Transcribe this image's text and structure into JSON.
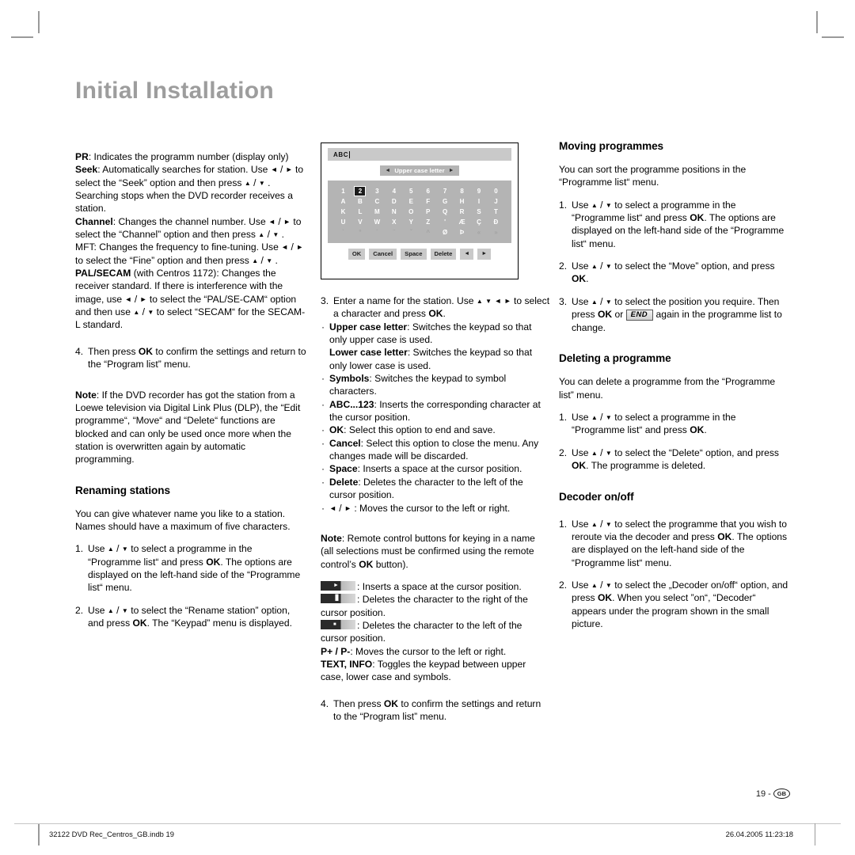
{
  "page": {
    "title": "Initial Installation",
    "page_number": "19",
    "region_badge": "GB"
  },
  "footer": {
    "file_name": "32122 DVD Rec_Centros_GB.indb   19",
    "timestamp": "26.04.2005   11:23:18"
  },
  "column1": {
    "pr_label": "PR",
    "pr_text": ": Indicates the programm number (display only)",
    "seek_label": "Seek",
    "seek_text_a": ": Automatically searches for station. Use",
    "seek_text_b": "to select the “Seek” option and then press",
    "seek_text_c": ". Searching stops when the DVD recorder receives a station.",
    "channel_label": "Channel",
    "channel_text_a": ": Changes the channel number. Use",
    "channel_text_b": "to select the “Channel” option and then press",
    "mft_text_a": "MFT: Changes the frequency to fine-tuning. Use",
    "mft_text_b": "to select the “Fine” option and then press",
    "pal_label": "PAL/SECAM",
    "pal_text_a": "(with Centros 1172): Changes the receiver standard. If there is interference with the image, use",
    "pal_text_b": "to select the “PAL/SE-CAM“ option and then use",
    "pal_text_c": "to select “SECAM“ for the SECAM-L standard.",
    "step4_marker": "4.",
    "step4_a": "Then press",
    "step4_ok": "OK",
    "step4_b": "to confirm the settings and return to the “Program list” menu.",
    "note_label": "Note",
    "note_text": ": If the DVD recorder has got the station from a Loewe television via Digital Link Plus (DLP), the “Edit programme“, “Move“ and “Delete“ functions are blocked and can only be used once more when the station is overwritten again by automatic programming.",
    "renaming_heading": "Renaming stations",
    "renaming_intro": "You can give whatever name you like to a station. Names should have a maximum of five characters.",
    "rn1_marker": "1.",
    "rn1_a": "Use",
    "rn1_b": "to select a programme in the “Programme list“ and press",
    "rn1_ok": "OK",
    "rn1_c": ". The options are displayed on the left-hand side of the “Programme list“ menu.",
    "rn2_marker": "2.",
    "rn2_a": "Use",
    "rn2_b": "to select the “Rename station” option, and press",
    "rn2_ok": "OK",
    "rn2_c": ". The “Keypad” menu is displayed."
  },
  "keypad_figure": {
    "entry_text": "ABC",
    "mode_label": "Upper case letter",
    "mode_arrow_left": "◄",
    "mode_arrow_right": "►",
    "rows": [
      [
        "1",
        "2",
        "3",
        "4",
        "5",
        "6",
        "7",
        "8",
        "9",
        "0"
      ],
      [
        "A",
        "B",
        "C",
        "D",
        "E",
        "F",
        "G",
        "H",
        "I",
        "J"
      ],
      [
        "K",
        "L",
        "M",
        "N",
        "O",
        "P",
        "Q",
        "R",
        "S",
        "T"
      ],
      [
        "U",
        "V",
        "W",
        "X",
        "Y",
        "Z",
        "'",
        "Æ",
        "Ç",
        "Ð"
      ],
      [
        "`",
        "°",
        "´",
        "¨",
        "ˇ",
        "^",
        "Ø",
        "Þ",
        "«",
        "»"
      ]
    ],
    "selected_key": "2",
    "buttons": [
      "OK",
      "Cancel",
      "Space",
      "Delete",
      "◄",
      "►"
    ]
  },
  "column2": {
    "step3_marker": "3.",
    "step3_a": "Enter a name for the station. Use",
    "step3_b": "to select a character and press",
    "step3_ok": "OK",
    "step3_c": ".",
    "upper_label": "Upper case letter",
    "upper_text": ": Switches the keypad so that only upper case is used.",
    "lower_label": "Lower case letter",
    "lower_text": ": Switches the keypad so that only lower case is used.",
    "symbols_label": "Symbols",
    "symbols_text": ": Switches the keypad to symbol characters.",
    "abc_label": "ABC...123",
    "abc_text": ": Inserts the corresponding character at the cursor position.",
    "ok_label": "OK",
    "ok_text": ": Select this option to end and save.",
    "cancel_label": "Cancel",
    "cancel_text": ": Select this option to close the menu. Any changes made will be discarded.",
    "space_label": "Space",
    "space_text": ": Inserts a space at the cursor position.",
    "delete_label": "Delete",
    "delete_text": ": Deletes the character to the left of the cursor position.",
    "cursor_text": ": Moves the cursor to the left or right.",
    "note_label": "Note",
    "note_a": ": Remote control buttons for keying in a name (all selections must be confirmed using the remote control’s",
    "note_ok": "OK",
    "note_b": "button).",
    "rc_play_text": ": Inserts a space at the cursor position.",
    "rc_pause_text": ": Deletes the character to the right of the cursor position.",
    "rc_stop_text": ": Deletes the character to the left of the cursor position.",
    "pminus_label": "P+ / P-",
    "pminus_text": ": Moves the cursor to the left or right.",
    "textinfo_label": "TEXT, INFO",
    "textinfo_text": ": Toggles the keypad between upper case, lower case and symbols.",
    "step4_marker": "4.",
    "step4_a": "Then press",
    "step4_ok": "OK",
    "step4_b": "to confirm the settings and return to the “Program list” menu."
  },
  "column3": {
    "moving_heading": "Moving programmes",
    "moving_intro": "You can sort the programme positions in the “Programme list“ menu.",
    "mv1_marker": "1.",
    "mv1_a": "Use",
    "mv1_b": "to select a programme in the “Programme list“ and press",
    "mv1_ok": "OK",
    "mv1_c": ". The options are displayed on the left-hand side of the “Programme list“ menu.",
    "mv2_marker": "2.",
    "mv2_a": "Use",
    "mv2_b": "to select the “Move” option, and press",
    "mv2_ok": "OK",
    "mv2_c": ".",
    "mv3_marker": "3.",
    "mv3_a": "Use",
    "mv3_b": "to select the position you require. Then press",
    "mv3_ok": "OK",
    "mv3_or": "or",
    "mv3_end": "END",
    "mv3_c": "again in the programme list to change.",
    "deleting_heading": "Deleting a programme",
    "deleting_intro": "You can delete a programme from the “Programme list” menu.",
    "dl1_marker": "1.",
    "dl1_a": "Use",
    "dl1_b": "to select a programme in the “Programme list“ and press",
    "dl1_ok": "OK",
    "dl1_c": ".",
    "dl2_marker": "2.",
    "dl2_a": "Use",
    "dl2_b": "to select the “Delete“ option, and press",
    "dl2_ok": "OK",
    "dl2_c": ". The programme is deleted.",
    "decoder_heading": "Decoder on/off",
    "dc1_marker": "1.",
    "dc1_a": "Use",
    "dc1_b": "to select the programme that you wish to reroute via the decoder and press",
    "dc1_ok": "OK",
    "dc1_c": ". The options are displayed on the left-hand side of the “Programme list“ menu.",
    "dc2_marker": "2.",
    "dc2_a": "Use",
    "dc2_b": "to select the „Decoder on/off“ option, and press",
    "dc2_ok": "OK",
    "dc2_c": ". When you select ”on“, “Decoder“ appears under the program shown in the small picture."
  }
}
